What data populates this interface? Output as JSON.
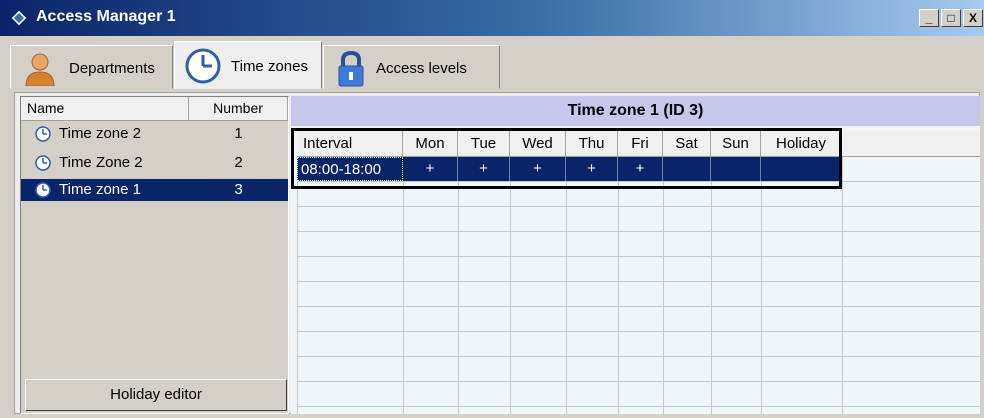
{
  "window": {
    "title": "Access Manager 1",
    "minimize_label": "_",
    "maximize_label": "□",
    "close_label": "X"
  },
  "tabs": [
    {
      "label": "Departments",
      "icon": "person-icon",
      "active": false
    },
    {
      "label": "Time zones",
      "icon": "clock-icon",
      "active": true
    },
    {
      "label": "Access levels",
      "icon": "padlock-icon",
      "active": false
    }
  ],
  "time_zone_list": {
    "columns": [
      "Name",
      "Number"
    ],
    "rows": [
      {
        "name": "Time zone 2",
        "number": "1",
        "selected": false
      },
      {
        "name": "Time Zone 2",
        "number": "2",
        "selected": false
      },
      {
        "name": "Time zone 1",
        "number": "3",
        "selected": true
      }
    ],
    "holiday_button": "Holiday editor"
  },
  "schedule": {
    "title": "Time zone 1 (ID 3)",
    "columns": [
      "Interval",
      "Mon",
      "Tue",
      "Wed",
      "Thu",
      "Fri",
      "Sat",
      "Sun",
      "Holiday"
    ],
    "rows": [
      {
        "cells": [
          "08:00-18:00",
          "+",
          "+",
          "+",
          "+",
          "+",
          "",
          "",
          ""
        ]
      }
    ]
  },
  "colors": {
    "selection": "#0a246a",
    "title_gradient_start": "#0a246a",
    "title_gradient_end": "#a6caf0",
    "header_band": "#c7c7ee",
    "grid_background": "#eef5fb"
  }
}
